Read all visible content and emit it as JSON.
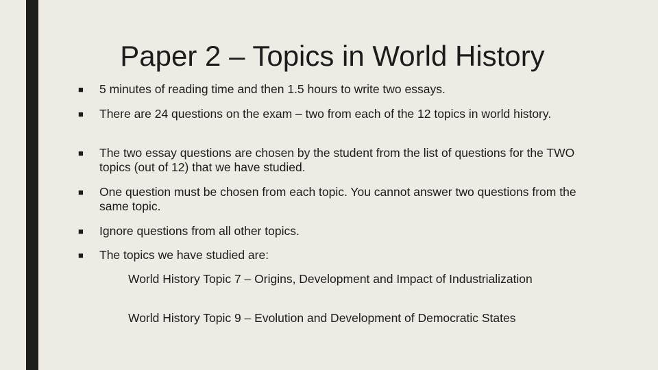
{
  "slide": {
    "title": "Paper 2 – Topics in World History",
    "bullet_marker": "■",
    "bullets": [
      {
        "text": "5 minutes of reading time and then 1.5 hours to write two essays."
      },
      {
        "text": "There are 24 questions on the exam – two from each of the 12 topics in world history."
      },
      {
        "text": "The two essay questions are chosen by the student from the list of questions for the TWO topics (out of 12) that we have studied."
      },
      {
        "text": "One question must be chosen from each topic.  You cannot answer two questions from the same topic."
      },
      {
        "text": "Ignore questions from all other topics."
      },
      {
        "text": "The topics we have studied are:"
      }
    ],
    "topics": [
      {
        "text": "World History Topic 7 – Origins, Development and Impact of Industrialization"
      },
      {
        "text": "World History Topic 9 – Evolution and Development of Democratic States"
      }
    ]
  }
}
